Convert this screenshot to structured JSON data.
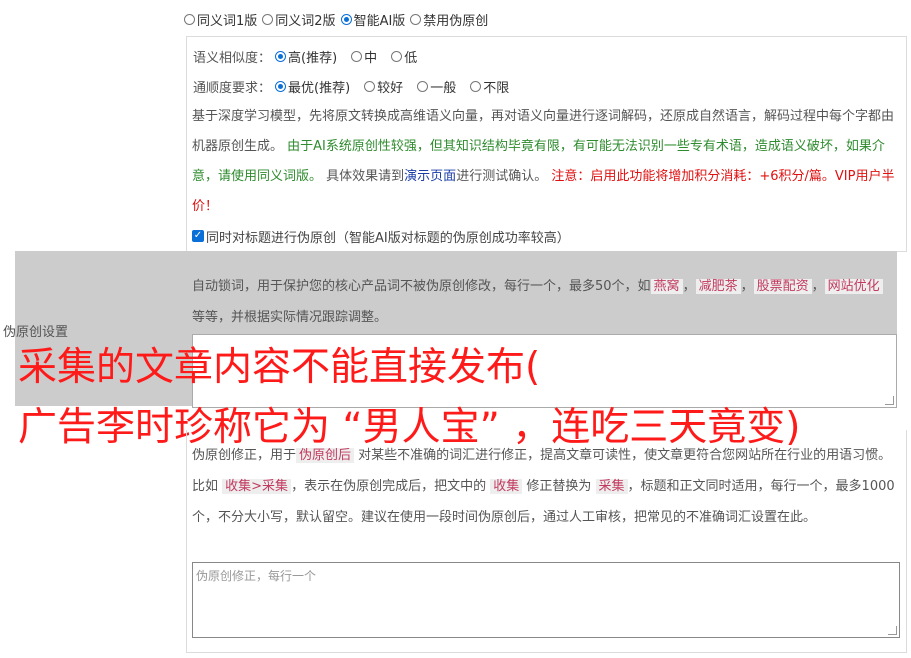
{
  "mode_options": [
    {
      "label": "同义词1版",
      "selected": false
    },
    {
      "label": "同义词2版",
      "selected": false
    },
    {
      "label": "智能AI版",
      "selected": true
    },
    {
      "label": "禁用伪原创",
      "selected": false
    }
  ],
  "similarity": {
    "label": "语义相似度：",
    "options": [
      {
        "label": "高(推荐)",
        "selected": true
      },
      {
        "label": "中",
        "selected": false
      },
      {
        "label": "低",
        "selected": false
      }
    ]
  },
  "fluency": {
    "label": "通顺度要求：",
    "options": [
      {
        "label": "最优(推荐)",
        "selected": true
      },
      {
        "label": "较好",
        "selected": false
      },
      {
        "label": "一般",
        "selected": false
      },
      {
        "label": "不限",
        "selected": false
      }
    ]
  },
  "description": {
    "part1": "基于深度学习模型，先将原文转换成高维语义向量，再对语义向量进行逐词解码，还原成自然语言，解码过程中每个字都由机器原创生成。",
    "part2": "由于AI系统原创性较强，但其知识结构毕竟有限，有可能无法识别一些专有术语，造成语义破坏，如果介意，请使用同义词版。",
    "part3": "具体效果请到",
    "link": "演示页面",
    "part4": "进行测试确认。",
    "warning": "注意：启用此功能将增加积分消耗：+6积分/篇。VIP用户半价！"
  },
  "title_checkbox": {
    "label": "同时对标题进行伪原创（智能AI版对标题的伪原创成功率较高）",
    "checked": true
  },
  "lock_words": {
    "text1": "自动锁词，用于保护您的核心产品词不被伪原创修改，每行一个，最多50个，如",
    "tags": [
      "燕窝",
      "减肥茶",
      "股票配资",
      "网站优化"
    ],
    "text2": "等等，并根据实际情况跟踪调整。"
  },
  "side_label": "伪原创设置",
  "overlay": {
    "line1": "采集的文章内容不能直接发布(",
    "line2": "广告李时珍称它为 “男人宝” ，连吃三天竟变)"
  },
  "correction": {
    "t1": "伪原创修正，用于",
    "tag1": "伪原创后",
    "t2": "对某些不准确的词汇进行修正，提高文章可读性，使文章更符合您网站所在行业的用语习惯。比如",
    "tag2": "收集>采集",
    "t3": "，表示在伪原创完成后，把文中的",
    "tag3": "收集",
    "t4": "修正替换为",
    "tag4": "采集",
    "t5": "，标题和正文同时适用，每行一个，最多1000个，不分大小写，默认留空。建议在使用一段时间伪原创后，通过人工审核，把常见的不准确词汇设置在此。",
    "placeholder": "伪原创修正，每行一个"
  }
}
